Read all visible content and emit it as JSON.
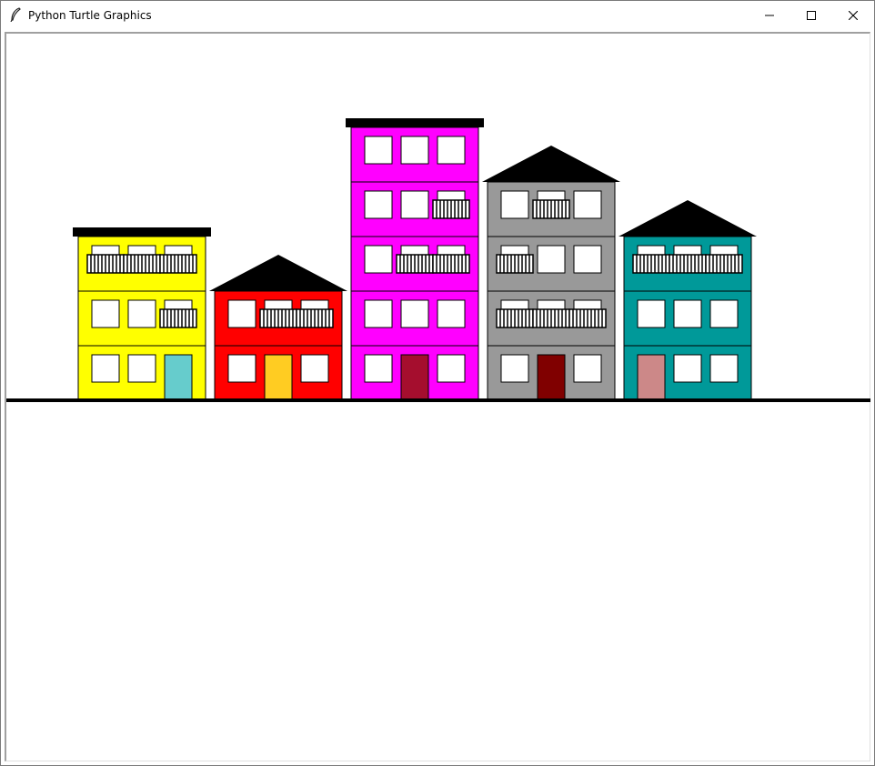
{
  "window": {
    "title": "Python Turtle Graphics",
    "icon": "feather-icon",
    "controls": [
      "minimize-icon",
      "maximize-icon",
      "close-icon"
    ]
  },
  "scene": {
    "ground_color": "#000000",
    "roof_color": "#000000",
    "window_color": "#ffffff",
    "buildings": [
      {
        "name": "yellow-building",
        "color": "#ffff00",
        "floors": 3,
        "roof": "flat",
        "door_color": "#66cccc"
      },
      {
        "name": "red-building",
        "color": "#ff0000",
        "floors": 2,
        "roof": "pitched",
        "door_color": "#ffcc22"
      },
      {
        "name": "magenta-building",
        "color": "#ff00ff",
        "floors": 5,
        "roof": "flat",
        "door_color": "#a50e2e"
      },
      {
        "name": "gray-building",
        "color": "#999999",
        "floors": 4,
        "roof": "pitched",
        "door_color": "#800000"
      },
      {
        "name": "teal-building",
        "color": "#009999",
        "floors": 3,
        "roof": "pitched",
        "door_color": "#cc8888"
      }
    ]
  }
}
